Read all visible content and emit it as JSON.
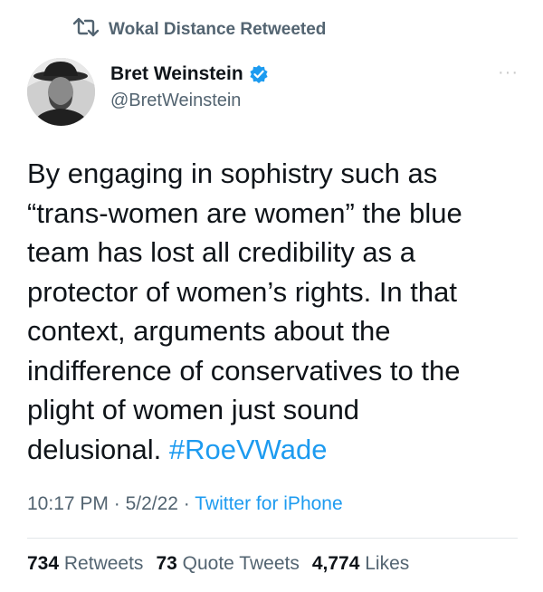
{
  "social_context": {
    "text": "Wokal Distance Retweeted",
    "icon": "retweet-icon"
  },
  "author": {
    "name": "Bret Weinstein",
    "handle": "@BretWeinstein",
    "verified": true
  },
  "menu": {
    "icon": "more-icon",
    "label": "···"
  },
  "tweet": {
    "text_lines": "By engaging in sophistry such as\n“trans-women are women” the blue\nteam has lost all credibility as a\nprotector of women’s rights. In that\ncontext, arguments about the\nindifference of conservatives to the\nplight of women just sound\ndelusional. ",
    "hashtag": "#RoeVWade"
  },
  "meta": {
    "time": "10:17 PM",
    "sep1": " · ",
    "date": "5/2/22",
    "sep2": " · ",
    "source": "Twitter for iPhone"
  },
  "stats": {
    "retweets_count": "734",
    "retweets_label": "Retweets",
    "quotes_count": "73",
    "quotes_label": "Quote Tweets",
    "likes_count": "4,774",
    "likes_label": "Likes"
  },
  "colors": {
    "accent": "#1d9bf0",
    "secondary_text": "#536471",
    "primary_text": "#0f1419"
  }
}
